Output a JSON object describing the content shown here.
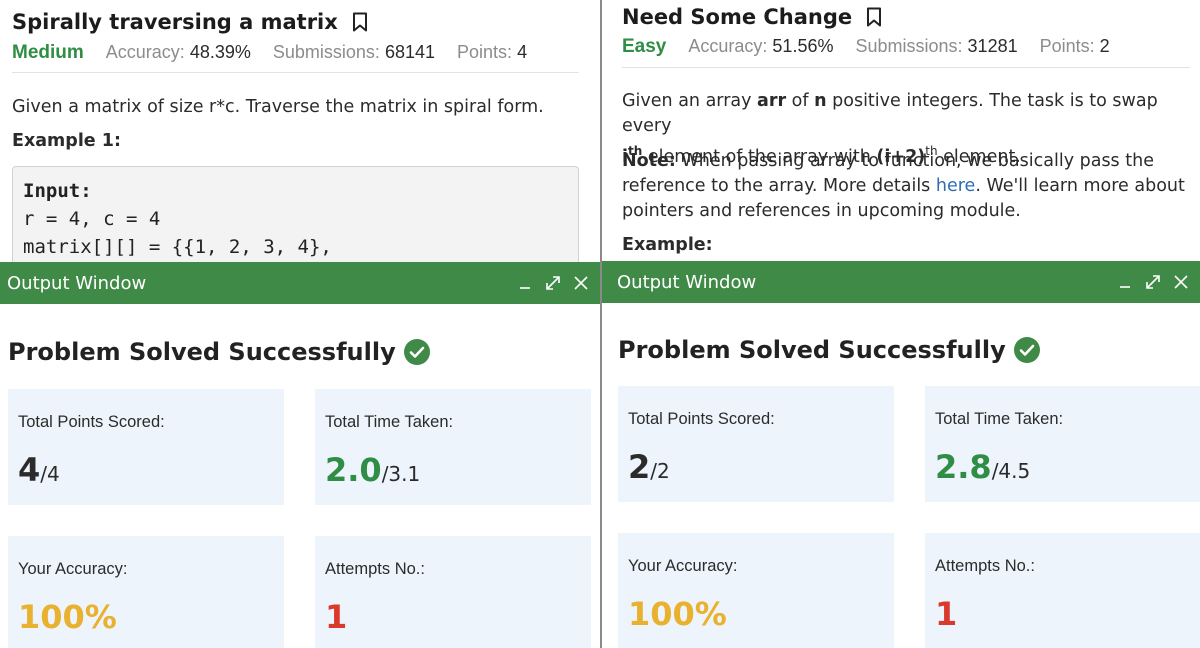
{
  "left": {
    "title": "Spirally traversing a matrix",
    "difficulty": "Medium",
    "accuracy_label": "Accuracy:",
    "accuracy_value": "48.39%",
    "submissions_label": "Submissions:",
    "submissions_value": "68141",
    "points_label": "Points:",
    "points_value": "4",
    "description": "Given a matrix of size r*c. Traverse the matrix in spiral form.",
    "example_label": "Example 1:",
    "code": {
      "input_label": "Input:",
      "line1": "r = 4, c = 4",
      "line2": "matrix[][] = {{1, 2, 3, 4},"
    },
    "output_window": {
      "title": "Output Window",
      "solved_text": "Problem Solved Successfully",
      "points_label": "Total Points Scored:",
      "points_scored": "4",
      "points_total": "/4",
      "time_label": "Total Time Taken:",
      "time_taken": "2.0",
      "time_total": "/3.1",
      "accuracy_label": "Your Accuracy:",
      "accuracy": "100%",
      "attempts_label": "Attempts No.:",
      "attempts": "1"
    }
  },
  "right": {
    "title": "Need Some Change",
    "difficulty": "Easy",
    "accuracy_label": "Accuracy:",
    "accuracy_value": "51.56%",
    "submissions_label": "Submissions:",
    "submissions_value": "31281",
    "points_label": "Points:",
    "points_value": "2",
    "desc": {
      "p1_a": "Given an array ",
      "p1_arr": "arr",
      "p1_b": " of ",
      "p1_n": "n",
      "p1_c": " positive integers. The task is to swap every",
      "p1_i": "i",
      "p1_th1": "th",
      "p1_d": " element of the array with ",
      "p1_i2": "(i+2)",
      "p1_th2": "th",
      "p1_e": " element.",
      "note_label": "Note:",
      "note_a": " When passing array to function, we basically pass the reference to the array. More details ",
      "note_link": "here",
      "note_b": ". We'll learn more about pointers and references in upcoming module."
    },
    "example_label": "Example:",
    "output_window": {
      "title": "Output Window",
      "solved_text": "Problem Solved Successfully",
      "points_label": "Total Points Scored:",
      "points_scored": "2",
      "points_total": "/2",
      "time_label": "Total Time Taken:",
      "time_taken": "2.8",
      "time_total": "/4.5",
      "accuracy_label": "Your Accuracy:",
      "accuracy": "100%",
      "attempts_label": "Attempts No.:",
      "attempts": "1"
    }
  },
  "icons": {
    "bookmark": "bookmark-icon",
    "check": "check-circle-icon",
    "minimize": "minimize-icon",
    "expand": "expand-icon",
    "close": "close-icon"
  },
  "colors": {
    "green_bar": "#3e8a46",
    "difficulty_green": "#2f8d46",
    "card_bg": "#eef4fb",
    "time_green": "#2f8d46",
    "accuracy_gold": "#e8b12e",
    "attempts_red": "#d93a2b",
    "link_blue": "#2e6db4"
  }
}
